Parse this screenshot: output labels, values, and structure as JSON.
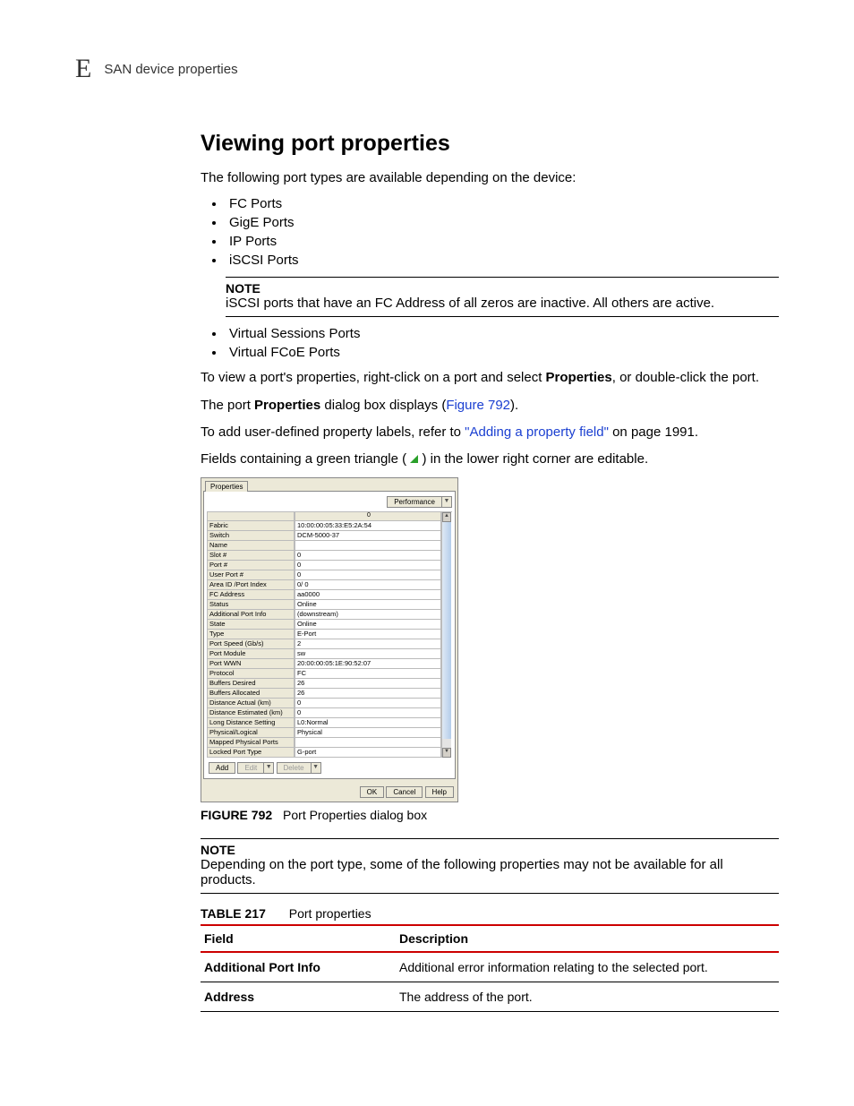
{
  "header": {
    "appendix_letter": "E",
    "running_title": "SAN device properties"
  },
  "main": {
    "title": "Viewing port properties",
    "intro": "The following port types are available depending on the device:",
    "port_types_1": [
      "FC Ports",
      "GigE Ports",
      "IP Ports",
      "iSCSI Ports"
    ],
    "note1": {
      "label": "NOTE",
      "text": "iSCSI ports that have an FC Address of all zeros are inactive. All others are active."
    },
    "port_types_2": [
      "Virtual Sessions Ports",
      "Virtual FCoE Ports"
    ],
    "para_view_pre": "To view a port's properties, right-click on a port and select ",
    "para_view_bold": "Properties",
    "para_view_post": ", or double-click the port.",
    "para_dialog_pre": "The port ",
    "para_dialog_bold": "Properties",
    "para_dialog_mid": " dialog box displays (",
    "para_dialog_link": "Figure 792",
    "para_dialog_end": ").",
    "para_add_pre": "To add user-defined property labels, refer to ",
    "para_add_link": "\"Adding a property field\"",
    "para_add_post": " on page 1991.",
    "para_tri_pre": "Fields containing a green triangle ( ",
    "para_tri_post": " ) in the lower right corner are editable."
  },
  "figure": {
    "label": "FIGURE 792",
    "caption": "Port Properties dialog box",
    "dialog": {
      "tab": "Properties",
      "performance_btn": "Performance",
      "col_header": "0",
      "rows": [
        {
          "label": "Fabric",
          "value": "10:00:00:05:33:E5:2A:54"
        },
        {
          "label": "Switch",
          "value": "DCM-5000-37"
        },
        {
          "label": "Name",
          "value": ""
        },
        {
          "label": "Slot #",
          "value": "0"
        },
        {
          "label": "Port #",
          "value": "0"
        },
        {
          "label": "User Port #",
          "value": "0"
        },
        {
          "label": "Area ID /Port Index",
          "value": "0/ 0"
        },
        {
          "label": "FC Address",
          "value": "aa0000"
        },
        {
          "label": "Status",
          "value": "Online"
        },
        {
          "label": "Additional Port Info",
          "value": "(downstream)"
        },
        {
          "label": "State",
          "value": "Online"
        },
        {
          "label": "Type",
          "value": "E-Port"
        },
        {
          "label": "Port Speed (Gb/s)",
          "value": "2"
        },
        {
          "label": "Port Module",
          "value": "sw"
        },
        {
          "label": "Port WWN",
          "value": "20:00:00:05:1E:90:52:07"
        },
        {
          "label": "Protocol",
          "value": "FC"
        },
        {
          "label": "Buffers Desired",
          "value": "26"
        },
        {
          "label": "Buffers Allocated",
          "value": "26"
        },
        {
          "label": "Distance Actual (km)",
          "value": "0"
        },
        {
          "label": "Distance Estimated (km)",
          "value": "0"
        },
        {
          "label": "Long Distance Setting",
          "value": "L0:Normal"
        },
        {
          "label": "Physical/Logical",
          "value": "Physical"
        },
        {
          "label": "Mapped Physical Ports",
          "value": ""
        },
        {
          "label": "Locked Port Type",
          "value": "G-port"
        }
      ],
      "buttons": {
        "add": "Add",
        "edit": "Edit",
        "delete": "Delete",
        "ok": "OK",
        "cancel": "Cancel",
        "help": "Help"
      }
    }
  },
  "note2": {
    "label": "NOTE",
    "text": "Depending on the port type, some of the following properties may not be available for all products."
  },
  "table217": {
    "label": "TABLE 217",
    "title": "Port properties",
    "headers": {
      "field": "Field",
      "description": "Description"
    },
    "rows": [
      {
        "field": "Additional Port Info",
        "description": "Additional error information relating to the selected port."
      },
      {
        "field": "Address",
        "description": "The address of the port."
      }
    ]
  }
}
